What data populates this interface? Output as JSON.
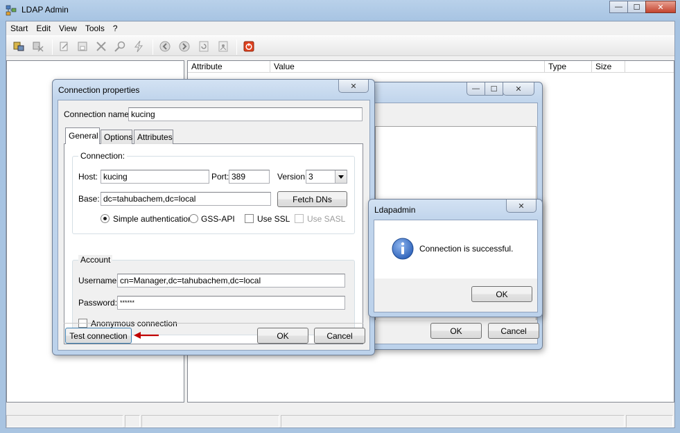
{
  "app": {
    "title": "LDAP Admin"
  },
  "window_controls": {
    "minimize": "—",
    "maximize": "☐",
    "close": "✕"
  },
  "menu": [
    "Start",
    "Edit",
    "View",
    "Tools",
    "?"
  ],
  "list_columns": [
    "Attribute",
    "Value",
    "Type",
    "Size"
  ],
  "connections_window": {
    "ok": "OK",
    "cancel": "Cancel"
  },
  "conn_props": {
    "title": "Connection properties",
    "name_label": "Connection name:",
    "name_value": "kucing",
    "tabs": [
      "General",
      "Options",
      "Attributes"
    ],
    "connection_group": "Connection:",
    "host_label": "Host:",
    "host_value": "kucing",
    "port_label": "Port:",
    "port_value": "389",
    "version_label": "Version:",
    "version_value": "3",
    "base_label": "Base:",
    "base_value": "dc=tahubachem,dc=local",
    "fetch_dns": "Fetch DNs",
    "simple_auth": "Simple authentication",
    "gss_api": "GSS-API",
    "use_ssl": "Use SSL",
    "use_sasl": "Use SASL",
    "account_group": "Account",
    "username_label": "Username:",
    "username_value": "cn=Manager,dc=tahubachem,dc=local",
    "password_label": "Password:",
    "password_value": "******",
    "anonymous": "Anonymous connection",
    "test_connection": "Test connection",
    "ok": "OK",
    "cancel": "Cancel"
  },
  "message": {
    "title": "Ldapadmin",
    "text": "Connection is successful.",
    "ok": "OK"
  },
  "colors": {
    "arrow": "#c00000",
    "info_icon": "#2a5fb8",
    "stop_icon": "#e0401e"
  }
}
